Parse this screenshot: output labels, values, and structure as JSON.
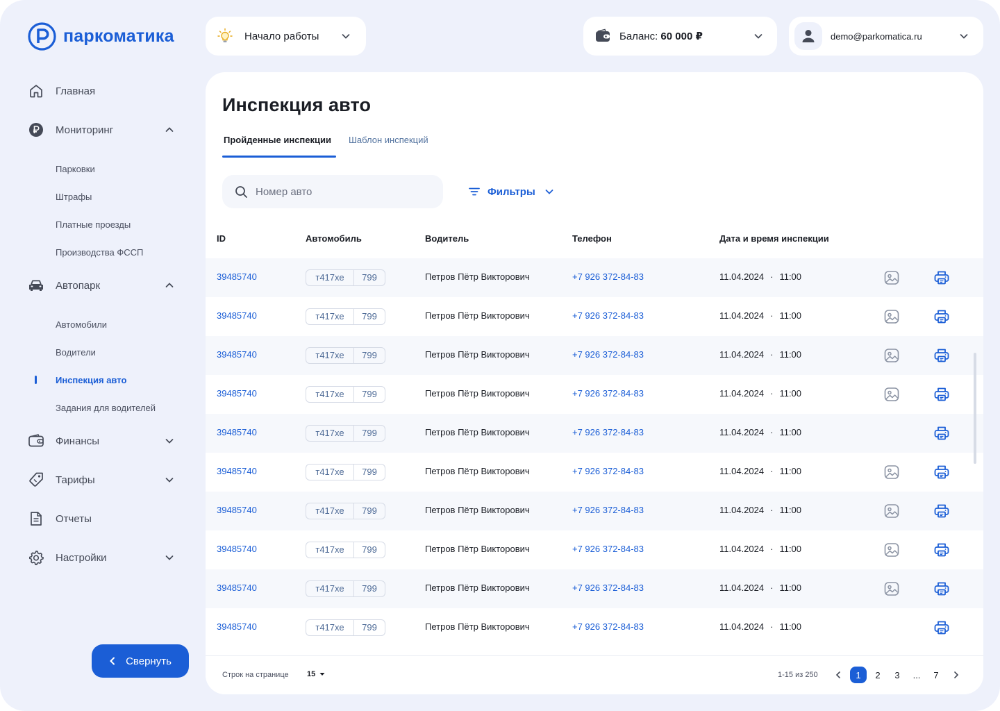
{
  "brand": {
    "name": "паркоматика",
    "color": "#1b5ed6"
  },
  "topbar": {
    "start": {
      "label": "Начало работы"
    },
    "balance": {
      "label": "Баланс:",
      "value": "60 000 ₽"
    },
    "user": {
      "email": "demo@parkomatica.ru"
    }
  },
  "sidebar": {
    "items": [
      {
        "label": "Главная",
        "icon": "home-icon"
      },
      {
        "label": "Мониторинг",
        "icon": "ruble-icon"
      },
      {
        "label": "Автопарк",
        "icon": "car-icon"
      },
      {
        "label": "Финансы",
        "icon": "wallet-icon"
      },
      {
        "label": "Тарифы",
        "icon": "tag-icon"
      },
      {
        "label": "Отчеты",
        "icon": "document-icon"
      },
      {
        "label": "Настройки",
        "icon": "gear-icon"
      }
    ],
    "monitoring_sub": [
      "Парковки",
      "Штрафы",
      "Платные проезды",
      "Производства ФССП"
    ],
    "fleet_sub": [
      "Автомобили",
      "Водители",
      "Инспекция авто",
      "Задания для водителей"
    ],
    "collapse_label": "Свернуть"
  },
  "page": {
    "title": "Инспекция авто",
    "tabs": [
      {
        "label": "Пройденные инспекции"
      },
      {
        "label": "Шаблон инспекций"
      }
    ],
    "search": {
      "placeholder": "Номер авто"
    },
    "filters_label": "Фильтры"
  },
  "table": {
    "headers": {
      "id": "ID",
      "car": "Автомобиль",
      "driver": "Водитель",
      "phone": "Телефон",
      "datetime": "Дата и время инспекции"
    },
    "rows": [
      {
        "id": "39485740",
        "plate": "т417хе",
        "region": "799",
        "driver": "Петров Пётр Викторович",
        "phone": "+7 926 372-84-83",
        "date": "11.04.2024",
        "time": "11:00",
        "has_photo": true
      },
      {
        "id": "39485740",
        "plate": "т417хе",
        "region": "799",
        "driver": "Петров Пётр Викторович",
        "phone": "+7 926 372-84-83",
        "date": "11.04.2024",
        "time": "11:00",
        "has_photo": true
      },
      {
        "id": "39485740",
        "plate": "т417хе",
        "region": "799",
        "driver": "Петров Пётр Викторович",
        "phone": "+7 926 372-84-83",
        "date": "11.04.2024",
        "time": "11:00",
        "has_photo": true
      },
      {
        "id": "39485740",
        "plate": "т417хе",
        "region": "799",
        "driver": "Петров Пётр Викторович",
        "phone": "+7 926 372-84-83",
        "date": "11.04.2024",
        "time": "11:00",
        "has_photo": true
      },
      {
        "id": "39485740",
        "plate": "т417хе",
        "region": "799",
        "driver": "Петров Пётр Викторович",
        "phone": "+7 926 372-84-83",
        "date": "11.04.2024",
        "time": "11:00",
        "has_photo": false
      },
      {
        "id": "39485740",
        "plate": "т417хе",
        "region": "799",
        "driver": "Петров Пётр Викторович",
        "phone": "+7 926 372-84-83",
        "date": "11.04.2024",
        "time": "11:00",
        "has_photo": true
      },
      {
        "id": "39485740",
        "plate": "т417хе",
        "region": "799",
        "driver": "Петров Пётр Викторович",
        "phone": "+7 926 372-84-83",
        "date": "11.04.2024",
        "time": "11:00",
        "has_photo": true
      },
      {
        "id": "39485740",
        "plate": "т417хе",
        "region": "799",
        "driver": "Петров Пётр Викторович",
        "phone": "+7 926 372-84-83",
        "date": "11.04.2024",
        "time": "11:00",
        "has_photo": true
      },
      {
        "id": "39485740",
        "plate": "т417хе",
        "region": "799",
        "driver": "Петров Пётр Викторович",
        "phone": "+7 926 372-84-83",
        "date": "11.04.2024",
        "time": "11:00",
        "has_photo": true
      },
      {
        "id": "39485740",
        "plate": "т417хе",
        "region": "799",
        "driver": "Петров Пётр Викторович",
        "phone": "+7 926 372-84-83",
        "date": "11.04.2024",
        "time": "11:00",
        "has_photo": false
      }
    ]
  },
  "footer": {
    "rows_per_page_label": "Строк на странице",
    "rows_per_page": "15",
    "range": "1-15 из 250",
    "pages": [
      "1",
      "2",
      "3",
      "...",
      "7"
    ],
    "current_page": "1"
  }
}
